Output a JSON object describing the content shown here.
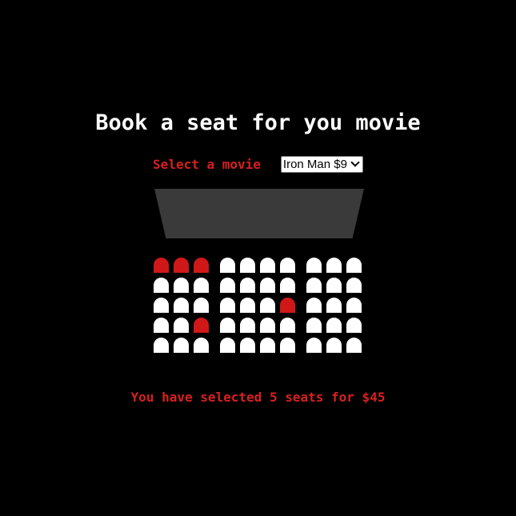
{
  "header": {
    "title": "Book a seat for you movie"
  },
  "movie_picker": {
    "label": "Select a movie",
    "selected": "Iron Man $9",
    "icon": "chevron-down-icon"
  },
  "theater": {
    "rows": [
      [
        "selected",
        "selected",
        "selected",
        "available",
        "available",
        "available",
        "available",
        "available",
        "available",
        "available"
      ],
      [
        "available",
        "available",
        "available",
        "available",
        "available",
        "available",
        "available",
        "available",
        "available",
        "available"
      ],
      [
        "available",
        "available",
        "available",
        "available",
        "available",
        "available",
        "selected",
        "available",
        "available",
        "available"
      ],
      [
        "available",
        "available",
        "selected",
        "available",
        "available",
        "available",
        "available",
        "available",
        "available",
        "available"
      ],
      [
        "available",
        "available",
        "available",
        "available",
        "available",
        "available",
        "available",
        "available",
        "available",
        "available"
      ]
    ]
  },
  "summary": {
    "prefix": "You have selected ",
    "count": "5",
    "middle": " seats for ",
    "total": "$45"
  },
  "colors": {
    "background": "#000000",
    "accent": "#d91f1f",
    "seat_available": "#ffffff",
    "seat_selected": "#d01818",
    "screen": "#3a3a3a"
  }
}
